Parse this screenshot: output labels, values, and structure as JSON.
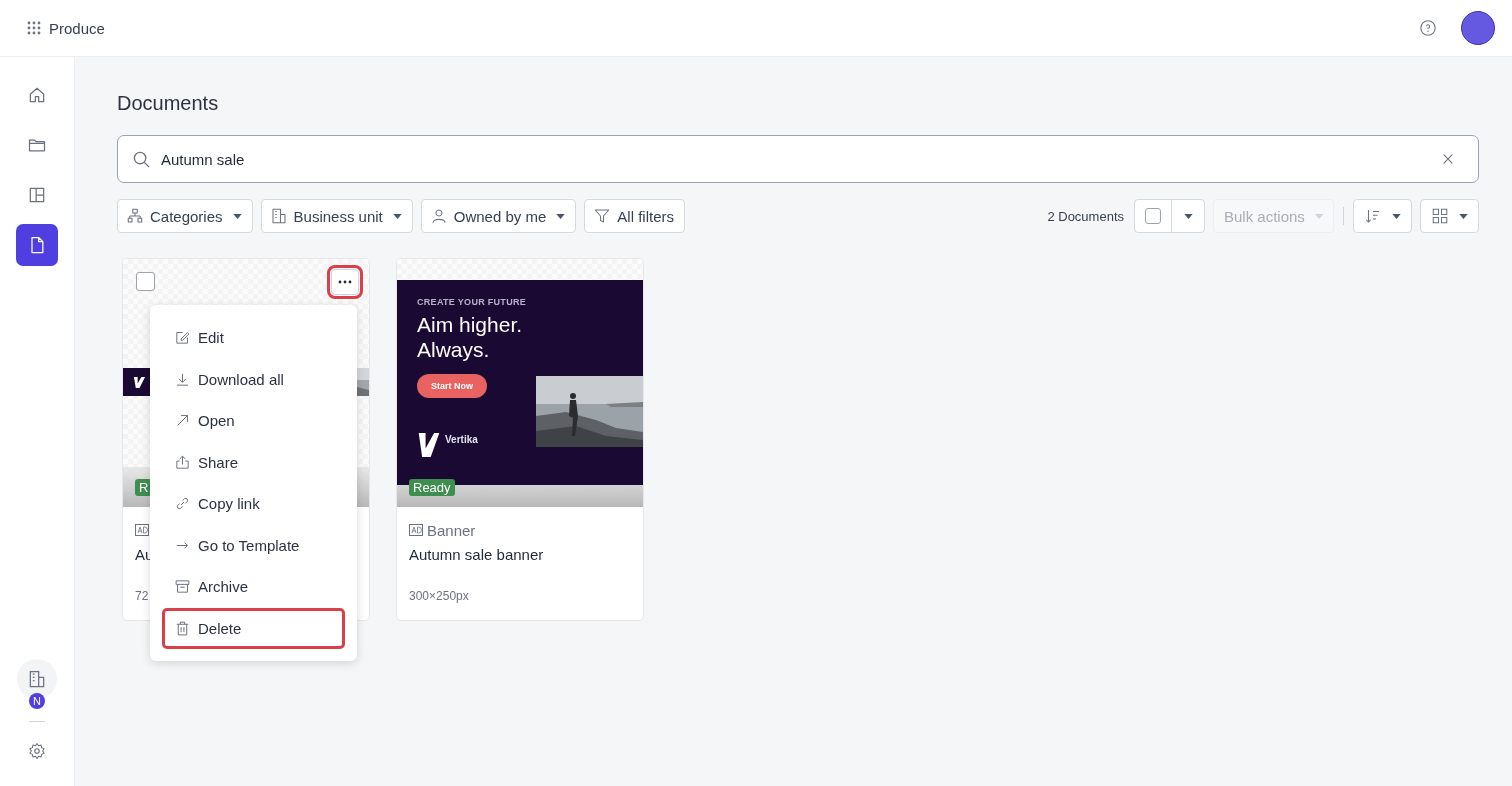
{
  "app": {
    "name": "Produce"
  },
  "sidebar": {
    "items": [
      {
        "kind": "home",
        "selected": false
      },
      {
        "kind": "folder",
        "selected": false
      },
      {
        "kind": "layout",
        "selected": false
      },
      {
        "kind": "document",
        "selected": true
      }
    ],
    "workspace_badge": "N"
  },
  "page_title": "Documents",
  "search": {
    "value": "Autumn sale"
  },
  "filters": [
    {
      "kind": "categories",
      "label": "Categories",
      "dropdown": true
    },
    {
      "kind": "business",
      "label": "Business unit",
      "dropdown": true
    },
    {
      "kind": "owner",
      "label": "Owned by me",
      "dropdown": true
    },
    {
      "kind": "all",
      "label": "All filters",
      "dropdown": false
    }
  ],
  "toolbar": {
    "count": "2 Documents",
    "select_all_checked": false,
    "bulk_actions": {
      "label": "Bulk actions",
      "disabled": true
    }
  },
  "cards": [
    {
      "kind": "leaderboard",
      "checked": false,
      "more_highlighted": true,
      "status": "R",
      "title": "Au",
      "size": "72"
    },
    {
      "kind": "banner",
      "status": "Ready",
      "type": "Banner",
      "title": "Autumn sale banner",
      "size": "300×250px",
      "banner": {
        "eyebrow": "CREATE YOUR FUTURE",
        "headline": [
          "Aim higher.",
          "Always."
        ],
        "cta": "Start Now",
        "brand": "Vertika"
      }
    }
  ],
  "menu": {
    "items": [
      {
        "kind": "edit",
        "label": "Edit",
        "highlighted": false
      },
      {
        "kind": "download",
        "label": "Download all",
        "highlighted": false
      },
      {
        "kind": "open",
        "label": "Open",
        "highlighted": false
      },
      {
        "kind": "share",
        "label": "Share",
        "highlighted": false
      },
      {
        "kind": "link",
        "label": "Copy link",
        "highlighted": false
      },
      {
        "kind": "template",
        "label": "Go to Template",
        "highlighted": false
      },
      {
        "kind": "archive",
        "label": "Archive",
        "highlighted": false
      },
      {
        "kind": "delete",
        "label": "Delete",
        "highlighted": true
      }
    ]
  }
}
